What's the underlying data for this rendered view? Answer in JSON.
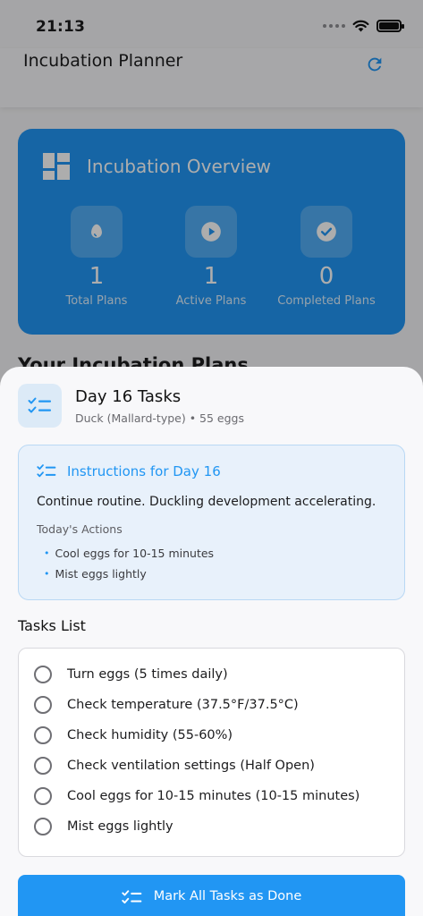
{
  "status_bar": {
    "time": "21:13"
  },
  "nav": {
    "title": "Incubation Planner",
    "refresh_icon": "refresh-icon"
  },
  "overview": {
    "title": "Incubation Overview",
    "icon": "dashboard-icon",
    "stats": [
      {
        "value": "1",
        "label": "Total Plans",
        "icon": "egg-icon"
      },
      {
        "value": "1",
        "label": "Active Plans",
        "icon": "play-icon"
      },
      {
        "value": "0",
        "label": "Completed Plans",
        "icon": "check-circle-icon"
      }
    ]
  },
  "plans_heading": "Your Incubation Plans",
  "sheet": {
    "title": "Day 16 Tasks",
    "subtitle": "Duck (Mallard-type) • 55 eggs",
    "icon": "checklist-icon",
    "instructions": {
      "title": "Instructions for Day 16",
      "text": "Continue routine. Duckling development accelerating.",
      "actions_label": "Today's Actions",
      "actions": [
        "Cool eggs for 10-15 minutes",
        "Mist eggs lightly"
      ]
    },
    "tasks_heading": "Tasks List",
    "tasks": [
      {
        "label": "Turn eggs (5 times daily)",
        "checked": false
      },
      {
        "label": "Check temperature (37.5°F/37.5°C)",
        "checked": false
      },
      {
        "label": "Check humidity (55-60%)",
        "checked": false
      },
      {
        "label": "Check ventilation settings (Half Open)",
        "checked": false
      },
      {
        "label": "Cool eggs for 10-15 minutes (10-15 minutes)",
        "checked": false
      },
      {
        "label": "Mist eggs lightly",
        "checked": false
      }
    ],
    "mark_all_label": "Mark All Tasks as Done"
  },
  "colors": {
    "accent": "#2196f3",
    "instructions_bg": "#e8f1fb",
    "dim_overlay": "rgba(0,0,0,0.32)"
  }
}
